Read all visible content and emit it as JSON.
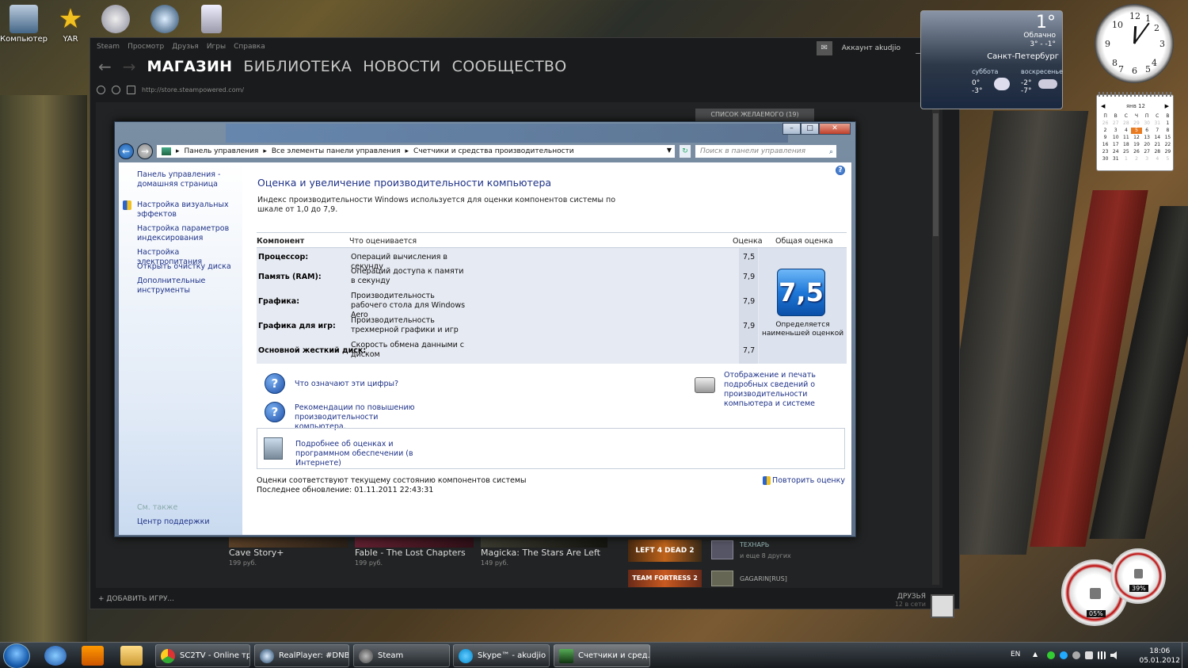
{
  "desktop": {
    "icons": [
      {
        "label": "Компьютер"
      },
      {
        "label": "YAR"
      },
      {
        "label": ""
      },
      {
        "label": ""
      },
      {
        "label": ""
      }
    ]
  },
  "steam": {
    "menu": [
      "Steam",
      "Просмотр",
      "Друзья",
      "Игры",
      "Справка"
    ],
    "tabs": [
      "МАГАЗИН",
      "БИБЛИОТЕКА",
      "НОВОСТИ",
      "СООБЩЕСТВО"
    ],
    "url": "http://store.steampowered.com/",
    "account": "Аккаунт akudjio",
    "wishlist": "СПИСОК ЖЕЛАЕМОГО (19)",
    "games": [
      {
        "title": "Cave Story+",
        "price": "199 руб."
      },
      {
        "title": "Fable - The Lost Chapters",
        "price": "199 руб."
      },
      {
        "title": "Magicka: The Stars Are Left",
        "price": "149 руб."
      }
    ],
    "friend_activity": [
      {
        "game": "LEFT 4 DEAD 2",
        "name": "ТЕХНАРЬ",
        "extra": "и еще 8 других"
      },
      {
        "game": "TEAM FORTRESS 2",
        "name": "GAGARIN[RUS]",
        "extra": ""
      }
    ],
    "add_game": "ДОБАВИТЬ ИГРУ...",
    "friends_label": "ДРУЗЬЯ",
    "friends_online": "12 в сети"
  },
  "control_panel": {
    "breadcrumb": [
      "Панель управления",
      "Все элементы панели управления",
      "Счетчики и средства производительности"
    ],
    "search_placeholder": "Поиск в панели управления",
    "sidebar": {
      "links": [
        "Панель управления - домашняя страница",
        "Настройка визуальных эффектов",
        "Настройка параметров индексирования",
        "Настройка электропитания",
        "Открыть очистку диска",
        "Дополнительные инструменты"
      ],
      "see_also": "См. также",
      "support": "Центр поддержки"
    },
    "title": "Оценка и увеличение производительности компьютера",
    "description": "Индекс производительности Windows используется для оценки компонентов системы по шкале от 1,0 до 7,9.",
    "table": {
      "headers": {
        "component": "Компонент",
        "rated": "Что оценивается",
        "score": "Оценка",
        "overall": "Общая оценка"
      },
      "rows": [
        {
          "component": "Процессор:",
          "rated": "Операций вычисления в секунду",
          "score": "7,5"
        },
        {
          "component": "Память (RAM):",
          "rated": "Операций доступа к памяти в секунду",
          "score": "7,9"
        },
        {
          "component": "Графика:",
          "rated": "Производительность рабочего стола для Windows Aero",
          "score": "7,9"
        },
        {
          "component": "Графика для игр:",
          "rated": "Производительность трехмерной графики и игр",
          "score": "7,9"
        },
        {
          "component": "Основной жесткий диск:",
          "rated": "Скорость обмена данными с диском",
          "score": "7,7"
        }
      ],
      "overall_score": "7,5",
      "overall_caption": "Определяется наименьшей оценкой"
    },
    "links": {
      "what_numbers": "Что означают эти цифры?",
      "recommendations": "Рекомендации по повышению производительности компьютера.",
      "print_details": "Отображение и печать подробных сведений о производительности компьютера и системе",
      "more_info": "Подробнее об оценках и программном обеспечении (в Интернете)"
    },
    "footer": {
      "status": "Оценки соответствуют текущему состоянию компонентов системы",
      "last_update": "Последнее обновление: 01.11.2011 22:43:31",
      "repeat": "Повторить оценку"
    }
  },
  "gadgets": {
    "weather": {
      "temp": "1°",
      "condition": "Облачно",
      "range": "3° - -1°",
      "city": "Санкт-Петербург",
      "days": [
        {
          "name": "суббота",
          "high": "0°",
          "low": "-3°"
        },
        {
          "name": "воскресенье",
          "high": "-2°",
          "low": "-7°"
        }
      ]
    },
    "calendar": {
      "month": "янв 12",
      "weekdays": [
        "П",
        "В",
        "С",
        "Ч",
        "П",
        "С",
        "В"
      ],
      "days": [
        "26",
        "27",
        "28",
        "29",
        "30",
        "31",
        "1",
        "2",
        "3",
        "4",
        "5",
        "6",
        "7",
        "8",
        "9",
        "10",
        "11",
        "12",
        "13",
        "14",
        "15",
        "16",
        "17",
        "18",
        "19",
        "20",
        "21",
        "22",
        "23",
        "24",
        "25",
        "26",
        "27",
        "28",
        "29",
        "30",
        "31",
        "1",
        "2",
        "3",
        "4",
        "5"
      ],
      "today": "5"
    },
    "cpu_meter": {
      "cpu": "05%",
      "ram": "39%"
    }
  },
  "taskbar": {
    "tasks": [
      {
        "label": "SC2TV - Online тр..."
      },
      {
        "label": "RealPlayer: #DNB..."
      },
      {
        "label": "Steam"
      },
      {
        "label": "Skype™ - akudjio"
      },
      {
        "label": "Счетчики и сред..."
      }
    ],
    "lang": "EN",
    "time": "18:06",
    "date": "05.01.2012"
  }
}
